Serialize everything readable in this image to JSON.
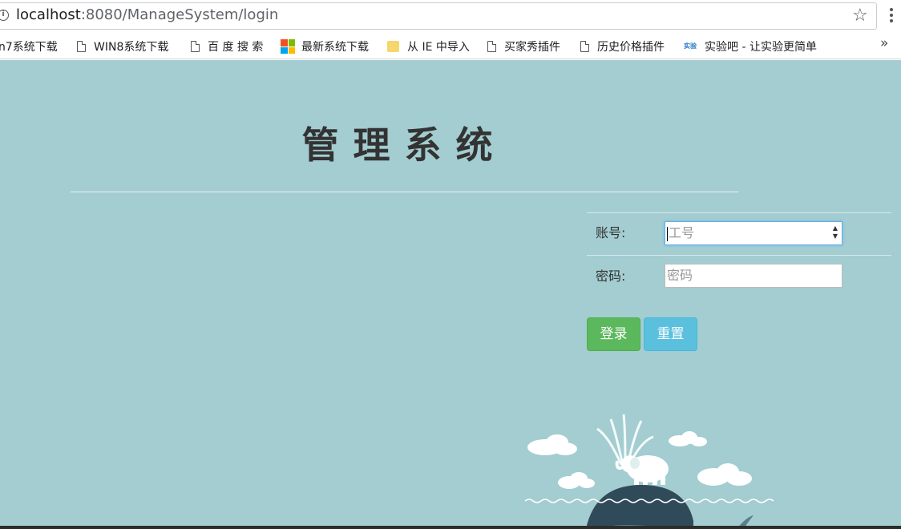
{
  "browser": {
    "url_host": "localhost",
    "url_rest": ":8080/ManageSystem/login"
  },
  "bookmarks": [
    {
      "label": "n7系统下载",
      "icon": "none"
    },
    {
      "label": "WIN8系统下载",
      "icon": "document-icon"
    },
    {
      "label": "百 度 搜 索",
      "icon": "document-icon"
    },
    {
      "label": "最新系统下载",
      "icon": "windows-icon"
    },
    {
      "label": "从 IE 中导入",
      "icon": "folder-icon"
    },
    {
      "label": "买家秀插件",
      "icon": "document-icon"
    },
    {
      "label": "历史价格插件",
      "icon": "document-icon"
    },
    {
      "label": "实验吧 - 让实验更简单",
      "icon": "lab-icon"
    }
  ],
  "page": {
    "title": "管理系统",
    "form": {
      "account_label": "账号:",
      "account_placeholder": "工号",
      "password_label": "密码:",
      "password_placeholder": "密码",
      "login_label": "登录",
      "reset_label": "重置"
    }
  },
  "colors": {
    "page_bg": "#a3cdd1",
    "login_btn": "#5cb85c",
    "reset_btn": "#5bc0de"
  }
}
